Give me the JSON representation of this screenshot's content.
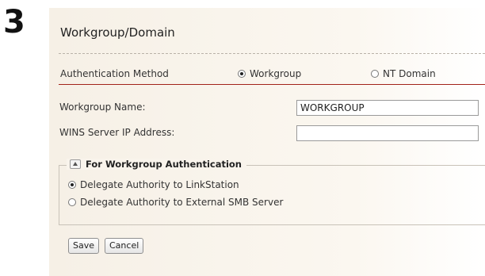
{
  "step_number": "3",
  "section": {
    "title": "Workgroup/Domain"
  },
  "auth_method": {
    "label": "Authentication Method",
    "options": [
      {
        "label": "Workgroup",
        "selected": true
      },
      {
        "label": "NT Domain",
        "selected": false
      }
    ]
  },
  "workgroup_name": {
    "label": "Workgroup Name:",
    "value": "WORKGROUP"
  },
  "wins_server": {
    "label": "WINS Server IP Address:",
    "value": ""
  },
  "workgroup_auth": {
    "legend": "For Workgroup Authentication",
    "options": [
      {
        "label": "Delegate Authority to LinkStation",
        "selected": true
      },
      {
        "label": "Delegate Authority to External SMB Server",
        "selected": false
      }
    ]
  },
  "buttons": {
    "save": "Save",
    "cancel": "Cancel"
  },
  "colors": {
    "accent_rule": "#a2231a",
    "panel_bg": "#f6f0e6"
  },
  "icons": {
    "collapse": "triangle-up-icon"
  }
}
